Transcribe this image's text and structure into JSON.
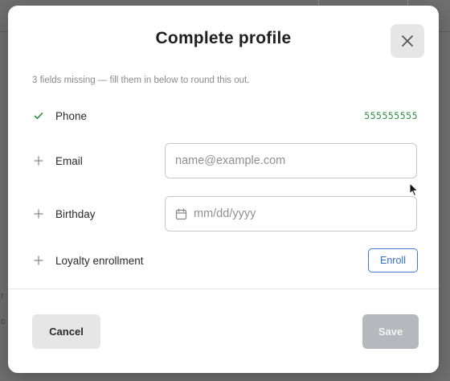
{
  "dialog": {
    "title": "Complete profile",
    "subtitle": "3 fields missing — fill them in below to round this out.",
    "close_icon": "close-icon"
  },
  "rows": {
    "phone": {
      "label": "Phone",
      "status_icon": "check-icon",
      "status": "complete",
      "value": "555555555"
    },
    "email": {
      "label": "Email",
      "status_icon": "plus-icon",
      "placeholder": "name@example.com",
      "value": ""
    },
    "birthday": {
      "label": "Birthday",
      "status_icon": "plus-icon",
      "field_icon": "calendar-icon",
      "placeholder": "mm/dd/yyyy",
      "value": ""
    },
    "loyalty": {
      "label": "Loyalty enrollment",
      "status_icon": "plus-icon",
      "button_label": "Enroll"
    }
  },
  "footer": {
    "cancel_label": "Cancel",
    "save_label": "Save",
    "save_enabled": false
  },
  "backdrop": {
    "edge_chars": [
      "r",
      "c"
    ]
  },
  "colors": {
    "success": "#2e8b3e",
    "accent": "#2f6fcf",
    "disabled": "#b5b8bc",
    "overlay": "#6f6f6f"
  }
}
